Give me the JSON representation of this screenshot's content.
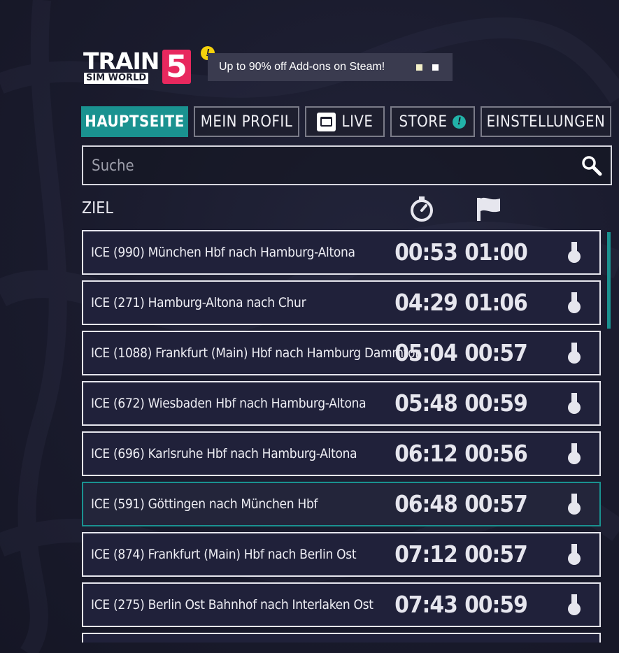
{
  "logo": {
    "train": "TRAIN",
    "sim_world": "SIM WORLD",
    "number": "5"
  },
  "promo": {
    "text": "Up to 90% off Add-ons on Steam!"
  },
  "nav": {
    "tabs": [
      {
        "label": "HAUPTSEITE",
        "active": true
      },
      {
        "label": "MEIN PROFIL",
        "active": false
      },
      {
        "label": "LIVE",
        "active": false
      },
      {
        "label": "STORE",
        "active": false
      },
      {
        "label": "EINSTELLUNGEN",
        "active": false
      }
    ]
  },
  "search": {
    "placeholder": "Suche",
    "value": ""
  },
  "list_header": {
    "ziel": "ZIEL"
  },
  "rows": [
    {
      "name": "ICE (990) München Hbf nach Hamburg-Altona",
      "time": "00:53",
      "duration": "01:00"
    },
    {
      "name": "ICE (271) Hamburg-Altona nach Chur",
      "time": "04:29",
      "duration": "01:06"
    },
    {
      "name": "ICE (1088) Frankfurt (Main) Hbf nach Hamburg Dammtor",
      "time": "05:04",
      "duration": "00:57"
    },
    {
      "name": "ICE (672) Wiesbaden Hbf nach Hamburg-Altona",
      "time": "05:48",
      "duration": "00:59"
    },
    {
      "name": "ICE (696) Karlsruhe Hbf nach Hamburg-Altona",
      "time": "06:12",
      "duration": "00:56"
    },
    {
      "name": "ICE (591) Göttingen nach München Hbf",
      "time": "06:48",
      "duration": "00:57"
    },
    {
      "name": "ICE (874) Frankfurt (Main) Hbf nach Berlin Ost",
      "time": "07:12",
      "duration": "00:57"
    },
    {
      "name": "ICE (275) Berlin Ost Bahnhof nach Interlaken Ost",
      "time": "07:43",
      "duration": "00:59"
    }
  ],
  "colors": {
    "accent": "#1a9290",
    "brand_pink": "#e8285e",
    "alert_yellow": "#f5d10c",
    "background": "#1a1b2d"
  }
}
